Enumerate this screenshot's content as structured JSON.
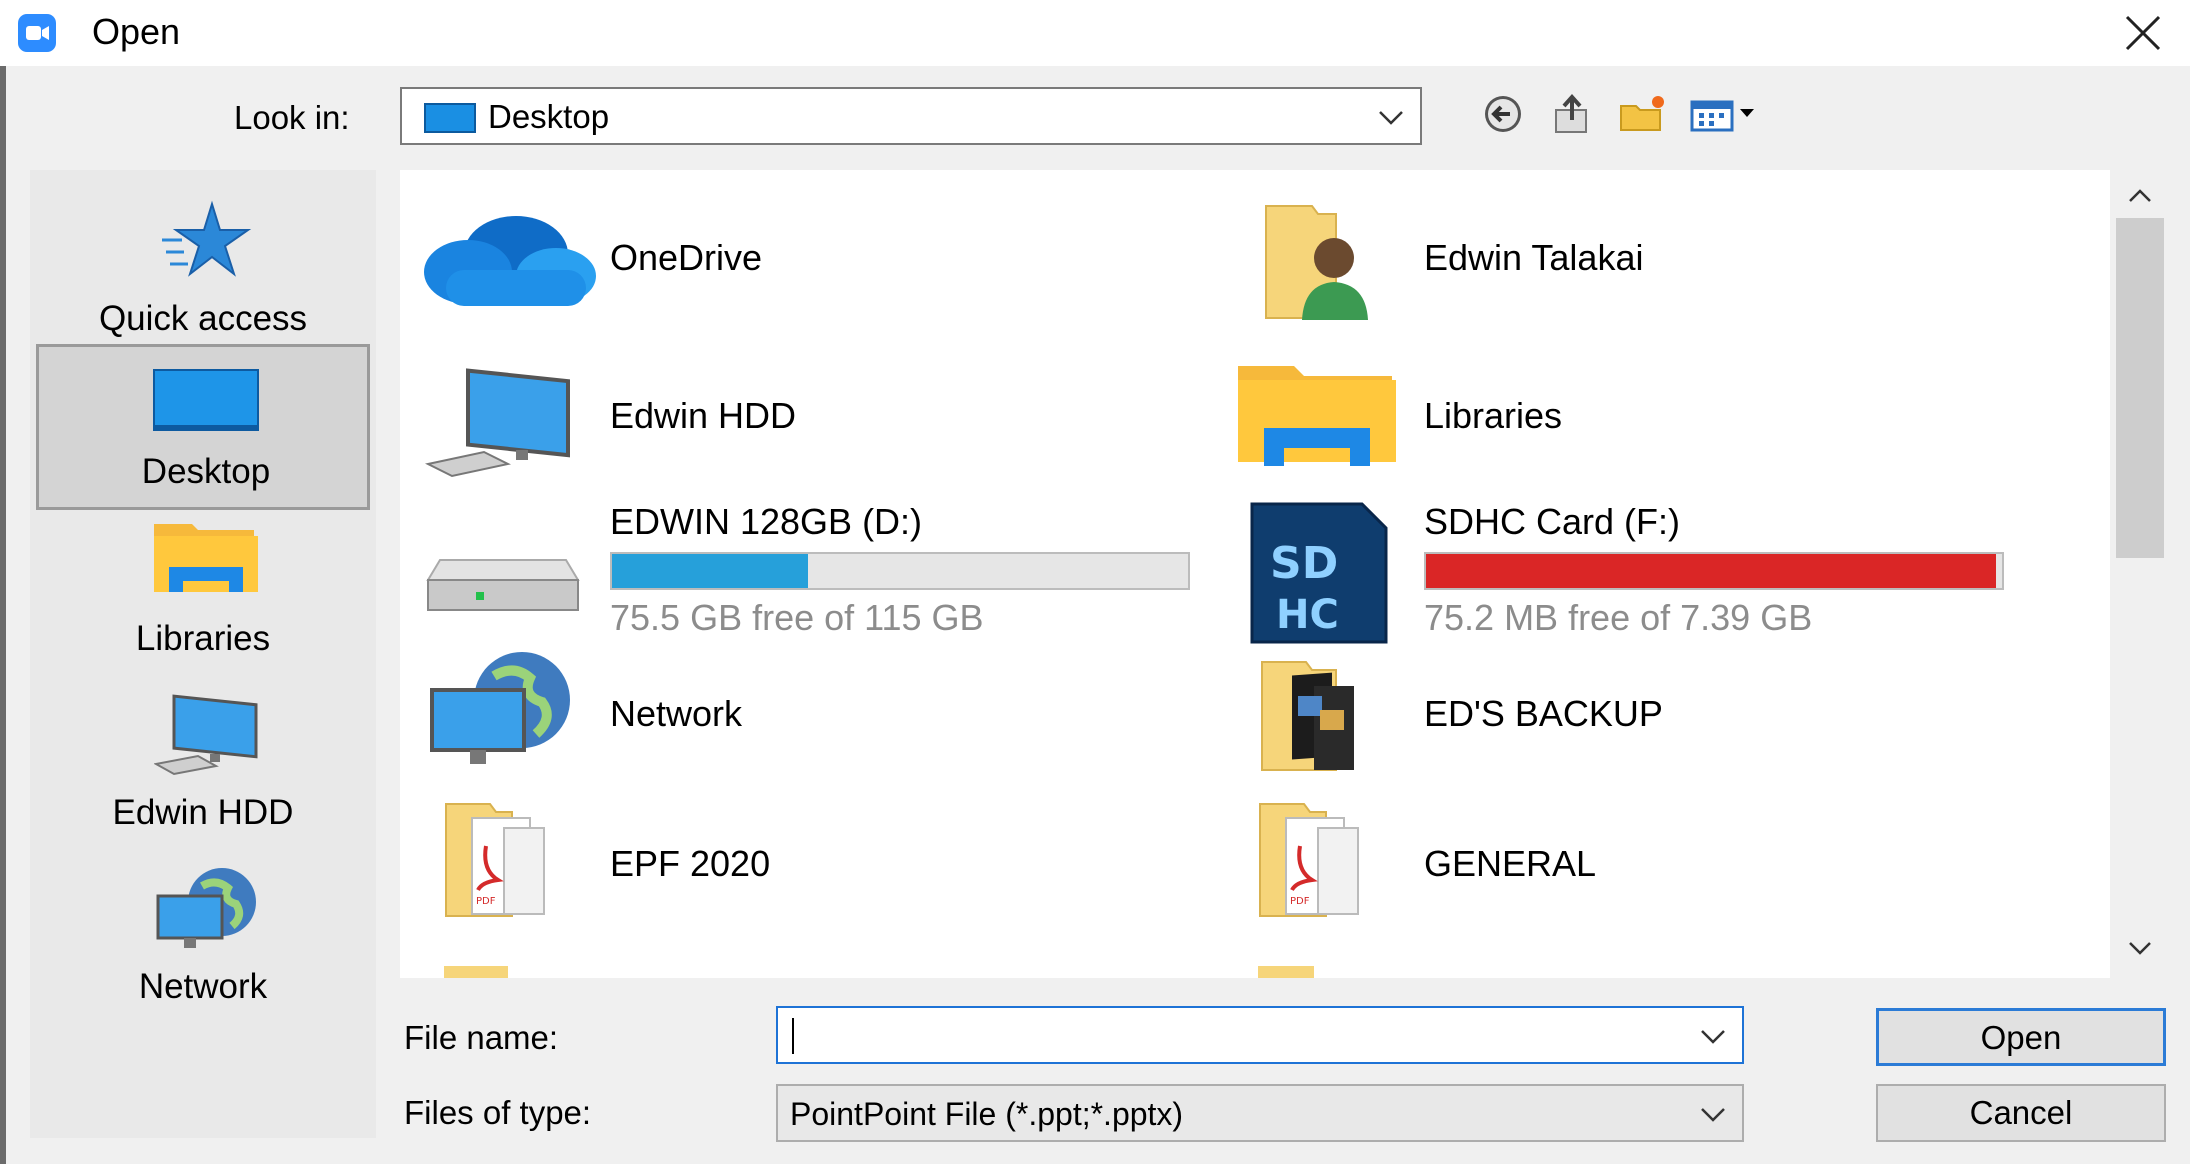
{
  "window": {
    "title": "Open"
  },
  "lookin": {
    "label": "Look in:",
    "value": "Desktop"
  },
  "places": [
    {
      "label": "Quick access",
      "icon": "star-icon"
    },
    {
      "label": "Desktop",
      "icon": "desktop-icon",
      "selected": true
    },
    {
      "label": "Libraries",
      "icon": "libraries-icon"
    },
    {
      "label": "Edwin HDD",
      "icon": "computer-icon"
    },
    {
      "label": "Network",
      "icon": "network-icon"
    }
  ],
  "items": [
    {
      "name": "OneDrive",
      "icon": "onedrive-icon"
    },
    {
      "name": "Edwin Talakai",
      "icon": "user-folder-icon"
    },
    {
      "name": "Edwin HDD",
      "icon": "computer-icon"
    },
    {
      "name": "Libraries",
      "icon": "libraries-icon"
    },
    {
      "name": "EDWIN 128GB (D:)",
      "icon": "drive-icon",
      "sub": "75.5 GB free of 115 GB",
      "used_fraction": 0.34,
      "bar_color": "#26a0da"
    },
    {
      "name": "SDHC Card (F:)",
      "icon": "sdhc-icon",
      "sub": "75.2 MB free of 7.39 GB",
      "used_fraction": 0.99,
      "bar_color": "#da2626"
    },
    {
      "name": "Network",
      "icon": "network-icon"
    },
    {
      "name": "ED'S BACKUP",
      "icon": "photo-folder-icon"
    },
    {
      "name": "EPF 2020",
      "icon": "pdf-folder-icon"
    },
    {
      "name": "GENERAL",
      "icon": "pdf-folder-icon"
    }
  ],
  "bottom": {
    "filename_label": "File name:",
    "filename_value": "",
    "filetype_label": "Files of type:",
    "filetype_value": "PointPoint File (*.ppt;*.pptx)",
    "open_label": "Open",
    "cancel_label": "Cancel"
  }
}
